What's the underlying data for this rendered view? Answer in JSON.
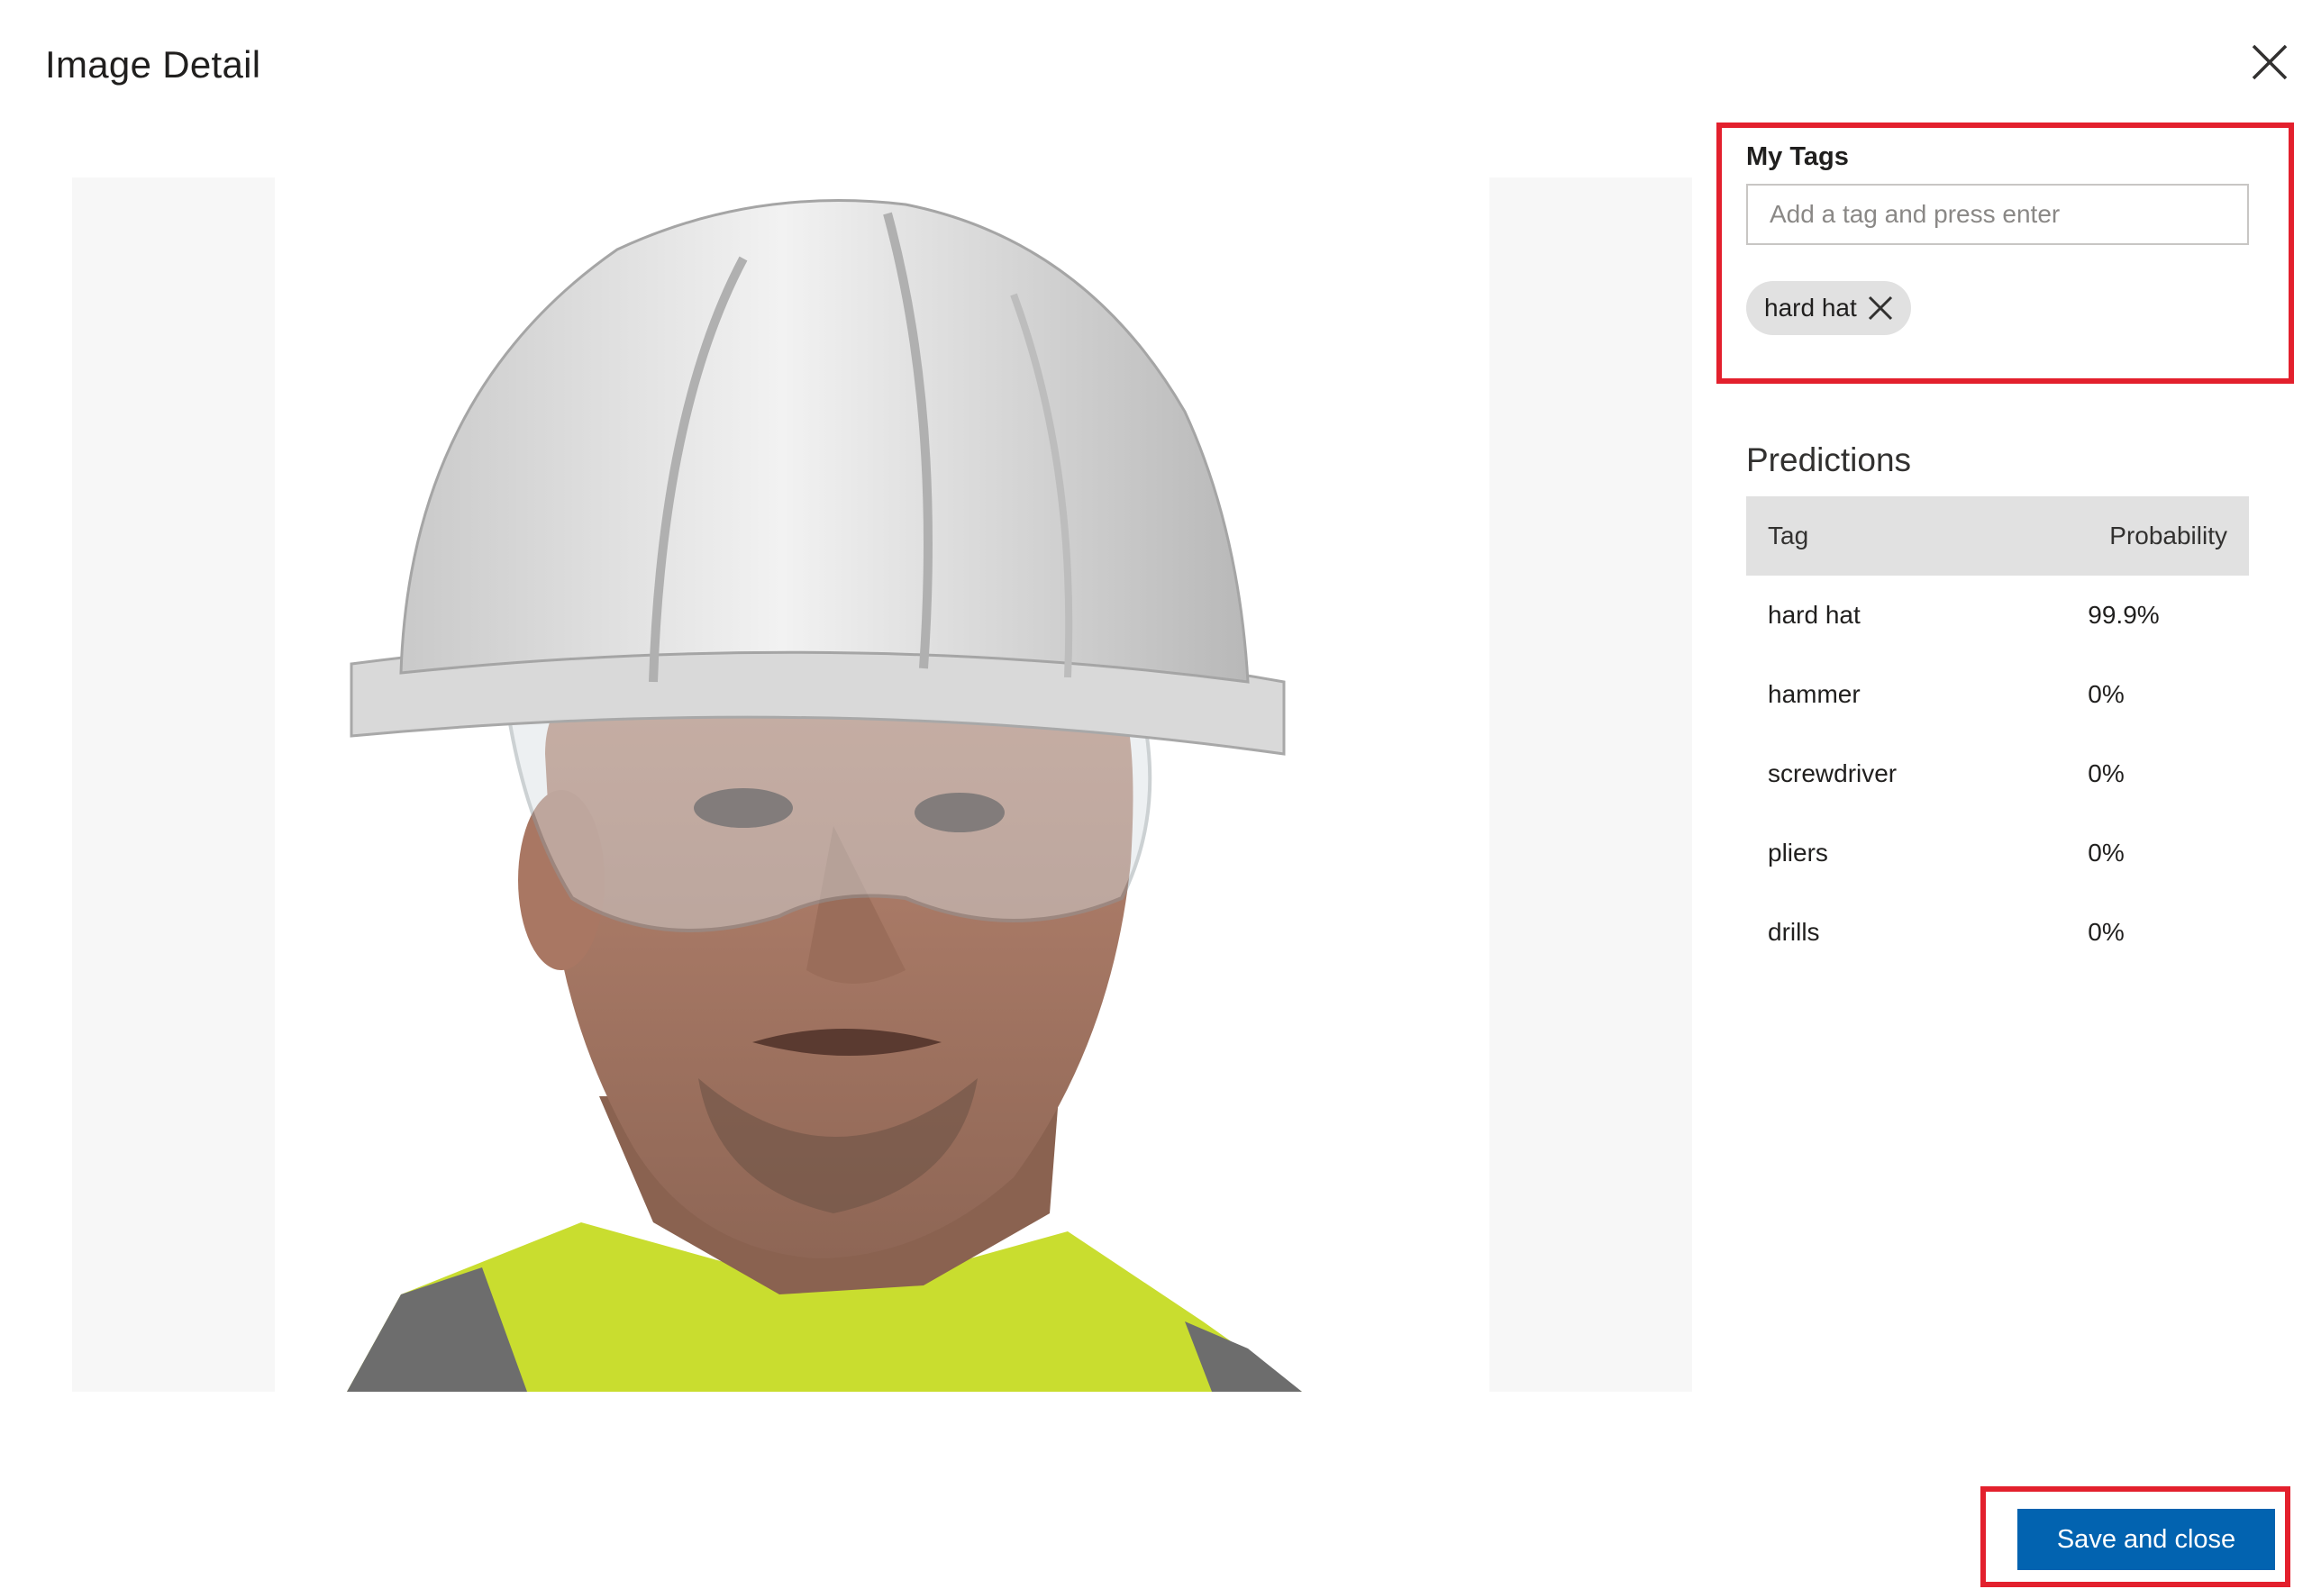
{
  "dialog": {
    "title": "Image Detail",
    "close_icon": "close-icon"
  },
  "my_tags": {
    "label": "My Tags",
    "input_value": "",
    "input_placeholder": "Add a tag and press enter",
    "tags": [
      {
        "label": "hard hat",
        "remove_icon": "close-icon"
      }
    ]
  },
  "predictions": {
    "title": "Predictions",
    "columns": {
      "tag": "Tag",
      "probability": "Probability"
    },
    "rows": [
      {
        "tag": "hard hat",
        "probability": "99.9%"
      },
      {
        "tag": "hammer",
        "probability": "0%"
      },
      {
        "tag": "screwdriver",
        "probability": "0%"
      },
      {
        "tag": "pliers",
        "probability": "0%"
      },
      {
        "tag": "drills",
        "probability": "0%"
      }
    ]
  },
  "footer": {
    "save_label": "Save and close",
    "save_color": "#0263b0"
  },
  "highlight_color": "#e3202d"
}
